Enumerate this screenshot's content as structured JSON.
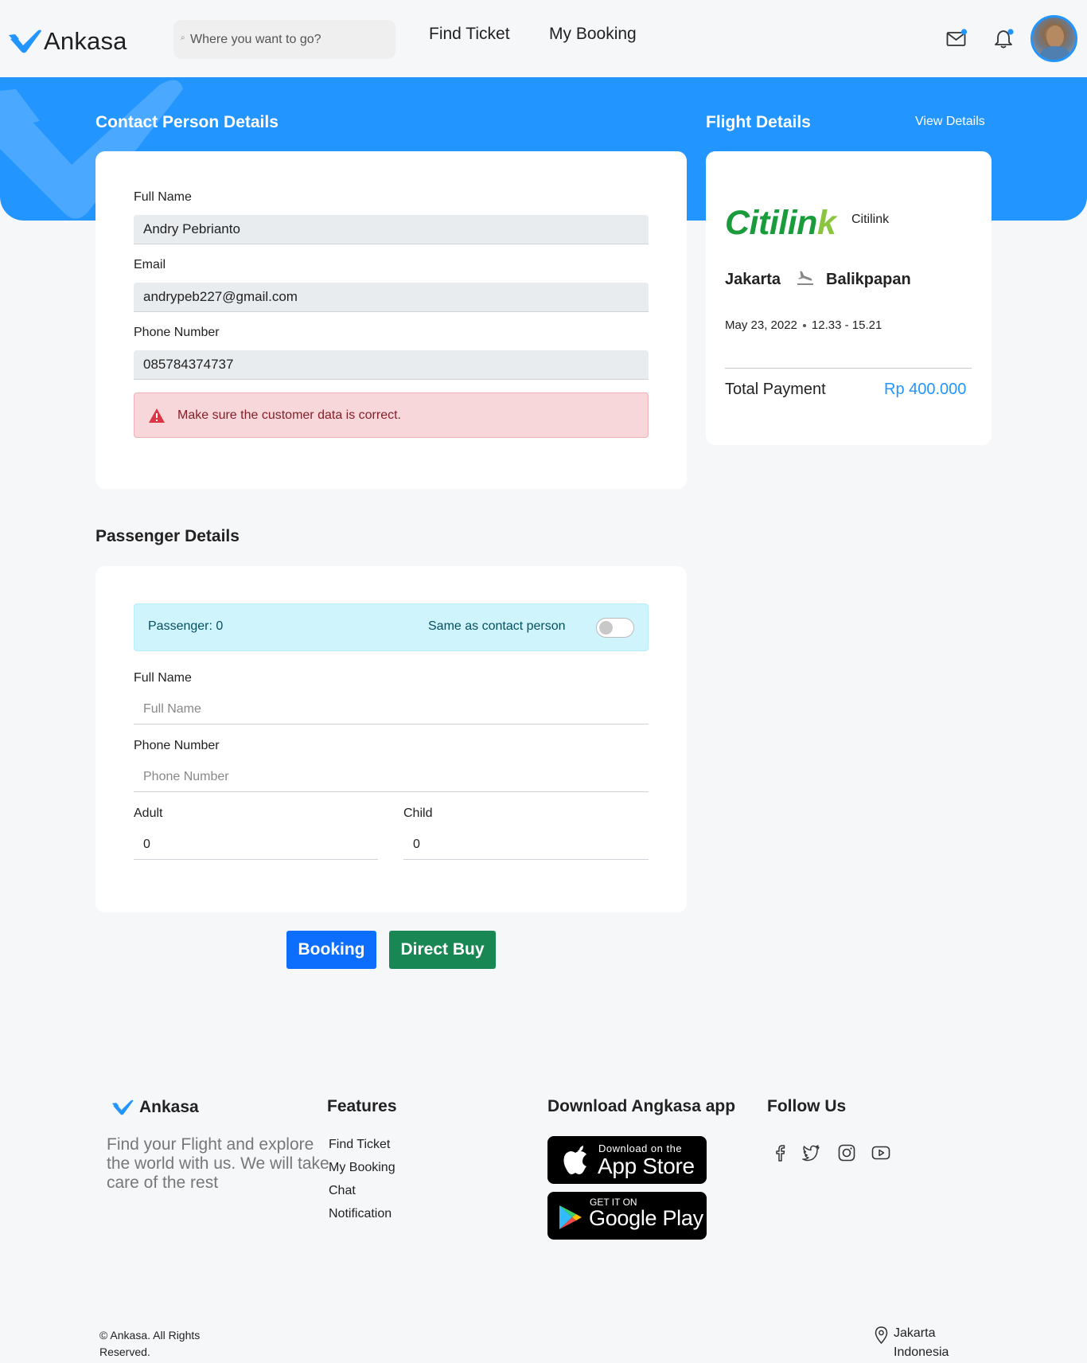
{
  "header": {
    "logo_text": "Ankasa",
    "search_placeholder": "Where you want to go?",
    "nav": [
      "Find Ticket",
      "My Booking"
    ]
  },
  "contact": {
    "title": "Contact Person Details",
    "full_name_label": "Full Name",
    "full_name_value": "Andry Pebrianto",
    "email_label": "Email",
    "email_value": "andrypeb227@gmail.com",
    "phone_label": "Phone Number",
    "phone_value": "085784374737",
    "alert_text": "Make sure the customer data is correct."
  },
  "flight": {
    "title": "Flight Details",
    "view_details": "View Details",
    "airline_logo_text": "Citilink",
    "airline_name": "Citilink",
    "from": "Jakarta",
    "to": "Balikpapan",
    "date": "May 23, 2022",
    "time": "12.33 - 15.21",
    "total_label": "Total Payment",
    "total_value": "Rp 400.000"
  },
  "passenger": {
    "title": "Passenger Details",
    "count_text": "Passenger: 0",
    "same_as_label": "Same as contact person",
    "same_as_enabled": false,
    "full_name_label": "Full Name",
    "full_name_placeholder": "Full Name",
    "phone_label": "Phone Number",
    "phone_placeholder": "Phone Number",
    "adult_label": "Adult",
    "adult_value": "0",
    "child_label": "Child",
    "child_value": "0"
  },
  "actions": {
    "booking_label": "Booking",
    "direct_buy_label": "Direct Buy"
  },
  "footer": {
    "logo_text": "Ankasa",
    "tagline": "Find your Flight and explore the world with us. We will take care of the rest",
    "features_heading": "Features",
    "features": [
      "Find Ticket",
      "My Booking",
      "Chat",
      "Notification"
    ],
    "download_heading": "Download Angkasa app",
    "app_store_small": "Download on the",
    "app_store_big": "App Store",
    "google_play_small": "GET IT ON",
    "google_play_big": "Google Play",
    "follow_heading": "Follow Us",
    "social_icons": [
      "facebook-icon",
      "twitter-icon",
      "instagram-icon",
      "youtube-icon"
    ],
    "copyright": "© Ankasa. All Rights Reserved.",
    "location": "Jakarta Indonesia"
  },
  "colors": {
    "primary": "#2395ff",
    "booking_button": "#0d6efd",
    "direct_buy_button": "#198754",
    "alert_bg": "#f8d7da",
    "info_bg": "#cff4fc",
    "airline_green": "#1a9b3c"
  }
}
